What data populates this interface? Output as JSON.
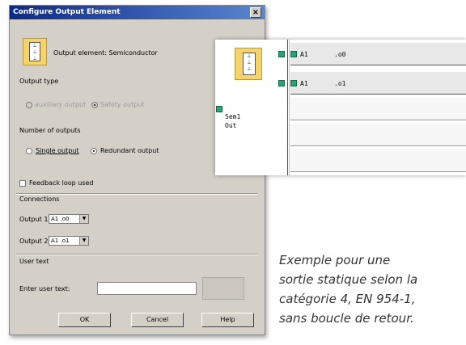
{
  "dialog": {
    "title": "Configure Output Element",
    "close": "×",
    "element_label": "Output element: Semiconductor",
    "output_type_label": "Output type",
    "output_type_options": [
      "auxiliary output",
      "Safety output"
    ],
    "number_outputs_label": "Number of outputs",
    "single_output": "Single output",
    "redundant_output": "Redundant output",
    "feedback_loop": "Feedback loop used",
    "connections_label": "Connections",
    "output1_label": "Output 1:",
    "output1_value": "A1 .o0",
    "output2_label": "Output 2:",
    "output2_value": "A1 .o1",
    "user_text_label": "User text",
    "enter_user_text_label": "Enter user text:",
    "enter_user_text_value": "",
    "buttons": {
      "ok": "OK",
      "cancel": "Cancel",
      "help": "Help"
    }
  },
  "panel": {
    "rows": [
      {
        "module": "A1",
        "pin": ".o0"
      },
      {
        "module": "A1",
        "pin": ".o1"
      }
    ],
    "block_label_line1": "Sem1",
    "block_label_line2": "Out"
  },
  "caption": {
    "lines": [
      "Exemple pour une",
      "sortie statique selon la",
      "catégorie 4, EN 954-1,",
      "sans boucle de retour."
    ]
  },
  "colors": {
    "titlebar_start": "#0a2a8c",
    "titlebar_end": "#5a86cf",
    "dialog_bg": "#d4d0c8",
    "icon_yellow": "#f6d46c",
    "pin_green": "#2aa376"
  },
  "icons": [
    "element-icon",
    "close-icon",
    "pin-icon",
    "dropdown-arrow-icon"
  ]
}
